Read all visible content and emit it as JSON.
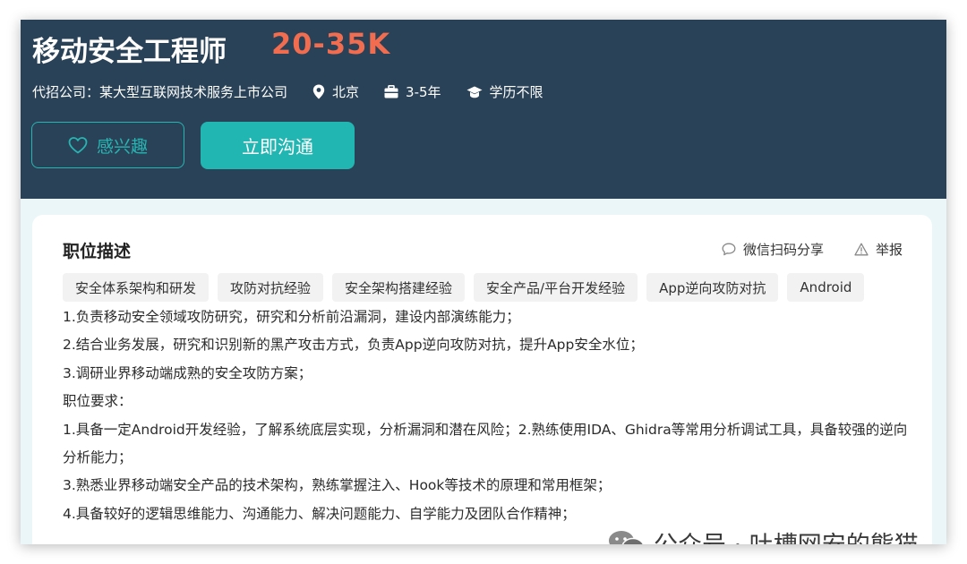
{
  "job": {
    "title": "移动安全工程师",
    "salary": "20-35K",
    "company": "代招公司：某大型互联网技术服务上市公司",
    "location": "北京",
    "experience": "3-5年",
    "education": "学历不限"
  },
  "actions": {
    "interest_label": "感兴趣",
    "chat_label": "立即沟通"
  },
  "description": {
    "section_title": "职位描述",
    "share_label": "微信扫码分享",
    "report_label": "举报",
    "tags": [
      "安全体系架构和研发",
      "攻防对抗经验",
      "安全架构搭建经验",
      "安全产品/平台开发经验",
      "App逆向攻防对抗",
      "Android"
    ],
    "lines": [
      "1.负责移动安全领域攻防研究，研究和分析前沿漏洞，建设内部演练能力；",
      "2.结合业务发展，研究和识别新的黑产攻击方式，负责App逆向攻防对抗，提升App安全水位；",
      "3.调研业界移动端成熟的安全攻防方案；",
      "职位要求：",
      "1.具备一定Android开发经验，了解系统底层实现，分析漏洞和潜在风险；2.熟练使用IDA、Ghidra等常用分析调试工具，具备较强的逆向分析能力；",
      "3.熟悉业界移动端安全产品的技术架构，熟练掌握注入、Hook等技术的原理和常用框架；",
      "4.具备较好的逻辑思维能力、沟通能力、解决问题能力、自学能力及团队合作精神；"
    ]
  },
  "watermark": {
    "text": "公众号 · 吐槽网安的熊猫",
    "icon": "wechat-icon"
  },
  "colors": {
    "header_bg": "#2a4257",
    "salary": "#f26d50",
    "accent": "#22b6b3",
    "page_bg": "#eaf6f7"
  }
}
